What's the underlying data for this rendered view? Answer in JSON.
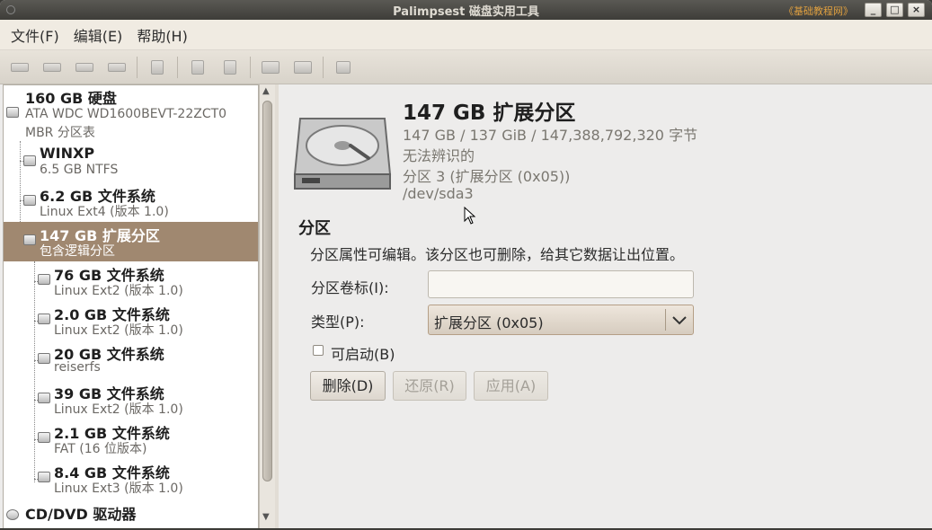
{
  "window": {
    "title": "Palimpsest 磁盘实用工具",
    "watermark": "《基础教程网》",
    "minimize": "_",
    "maximize": "□",
    "close": "×"
  },
  "menu": {
    "file": "文件(F)",
    "edit": "编辑(E)",
    "help": "帮助(H)"
  },
  "toolbar": {
    "icons": [
      "mount-icon",
      "eject-icon",
      "detach-icon",
      "unmount-icon",
      "check-icon",
      "benchmark-icon",
      "smart-icon",
      "format-icon",
      "create-partition-icon",
      "edit-icon"
    ]
  },
  "tree": [
    {
      "title": "160 GB 硬盘",
      "line1": "ATA WDC WD1600BEVT-22ZCT0",
      "line2": "MBR 分区表"
    },
    {
      "title": "WINXP",
      "sub": "6.5 GB NTFS"
    },
    {
      "title": "6.2 GB 文件系统",
      "sub": "Linux Ext4 (版本 1.0)"
    },
    {
      "title": "147 GB 扩展分区",
      "sub": "包含逻辑分区"
    },
    {
      "title": "76 GB 文件系统",
      "sub": "Linux Ext2 (版本 1.0)"
    },
    {
      "title": "2.0 GB 文件系统",
      "sub": "Linux Ext2 (版本 1.0)"
    },
    {
      "title": "20 GB 文件系统",
      "sub": "reiserfs"
    },
    {
      "title": "39 GB 文件系统",
      "sub": "Linux Ext2 (版本 1.0)"
    },
    {
      "title": "2.1 GB 文件系统",
      "sub": "FAT (16 位版本)"
    },
    {
      "title": "8.4 GB 文件系统",
      "sub": "Linux Ext3 (版本 1.0)"
    },
    {
      "title": "CD/DVD 驱动器",
      "sub": ""
    }
  ],
  "detail": {
    "title": "147 GB 扩展分区",
    "size": "147 GB / 137 GiB / 147,388,792,320 字节",
    "status": "无法辨识的",
    "partition": "分区 3 (扩展分区 (0x05))",
    "device": "/dev/sda3"
  },
  "partition": {
    "section_title": "分区",
    "description": "分区属性可编辑。该分区也可删除，给其它数据让出位置。",
    "label_label": "分区卷标(I):",
    "label_value": "",
    "type_label": "类型(P):",
    "type_value": "扩展分区 (0x05)",
    "bootable_label": "可启动(B)",
    "bootable_checked": false,
    "delete_button": "删除(D)",
    "revert_button": "还原(R)",
    "apply_button": "应用(A)"
  }
}
